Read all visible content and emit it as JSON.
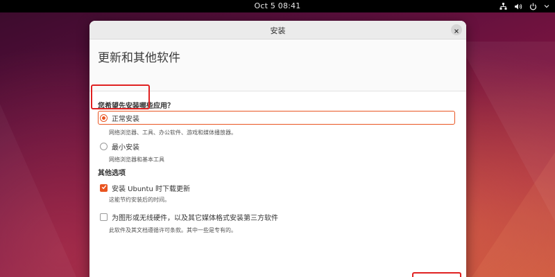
{
  "topbar": {
    "clock": "Oct 5  08:41",
    "icons": [
      "network-icon",
      "volume-icon",
      "power-icon"
    ]
  },
  "window": {
    "title": "安装",
    "close_icon": "close-icon"
  },
  "page": {
    "title": "更新和其他软件"
  },
  "install_type": {
    "question": "您希望先安装哪些应用？",
    "options": [
      {
        "label": "正常安装",
        "description": "网络浏览器、工具、办公软件、游戏和媒体播放器。",
        "selected": true
      },
      {
        "label": "最小安装",
        "description": "网络浏览器和基本工具",
        "selected": false
      }
    ]
  },
  "other_options": {
    "title": "其他选项",
    "items": [
      {
        "label": "安装 Ubuntu 时下载更新",
        "description": "这能节约安装后的时间。",
        "checked": true
      },
      {
        "label": "为图形或无线硬件，以及其它媒体格式安装第三方软件",
        "description": "此软件及其文档遵循许可条款。其中一些是专有的。",
        "checked": false
      }
    ]
  },
  "colors": {
    "accent": "#e95420",
    "annotation": "#e02020"
  }
}
